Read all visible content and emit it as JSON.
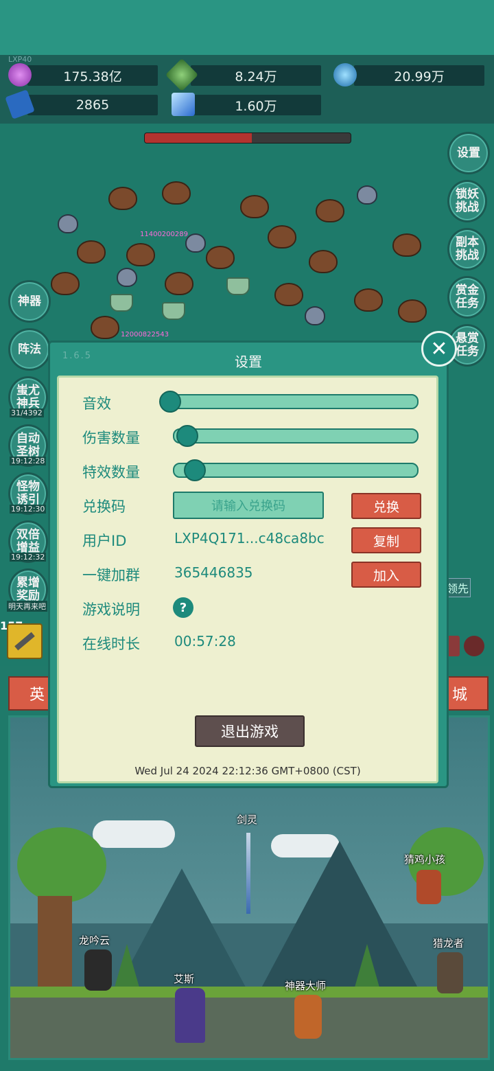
{
  "resources": {
    "level": "LXP40",
    "gem": "175.38亿",
    "green_crystal": "8.24万",
    "orb": "20.99万",
    "book": "2865",
    "blue_crystal": "1.60万"
  },
  "boss_hp_fraction": 0.52,
  "damage_numbers": [
    "11400200289",
    "12000822543"
  ],
  "left_menu": [
    {
      "label": "神器",
      "sub": ""
    },
    {
      "label": "阵法",
      "sub": ""
    },
    {
      "label": "蚩尤神兵",
      "sub": "31/4392"
    },
    {
      "label": "自动圣树",
      "sub": "19:12:28"
    },
    {
      "label": "怪物诱引",
      "sub": "19:12:30"
    },
    {
      "label": "双倍增益",
      "sub": "19:12:32"
    },
    {
      "label": "累增奖励",
      "sub": "明天再来吧"
    }
  ],
  "right_menu": [
    {
      "label": "设置"
    },
    {
      "label": "锁妖挑战"
    },
    {
      "label": "副本挑战"
    },
    {
      "label": "赏金任务"
    },
    {
      "label": "悬赏任务"
    }
  ],
  "partial": {
    "priority_tag": "领先",
    "counter": "157",
    "tab_left": "英",
    "tab_right": "城"
  },
  "settings": {
    "version": "1.6.5",
    "title": "设置",
    "sound_label": "音效",
    "sound_value": 0.0,
    "damage_count_label": "伤害数量",
    "damage_count_value": 0.05,
    "effect_count_label": "特效数量",
    "effect_count_value": 0.08,
    "redeem_label": "兑换码",
    "redeem_placeholder": "请输入兑换码",
    "redeem_button": "兑换",
    "user_id_label": "用户ID",
    "user_id_value": "LXP4Q171...c48ca8bc",
    "copy_button": "复制",
    "group_label": "一键加群",
    "group_value": "365446835",
    "join_button": "加入",
    "guide_label": "游戏说明",
    "guide_icon": "?",
    "online_label": "在线时长",
    "online_value": "00:57:28",
    "exit_button": "退出游戏",
    "datetime": "Wed Jul 24 2024 22:12:36 GMT+0800 (CST)"
  },
  "characters": {
    "sword": "剑灵",
    "chicken_kid": "猜鸡小孩",
    "long_yinyun": "龙吟云",
    "dragon_hunter": "猎龙者",
    "aisi": "艾斯",
    "artifact_master": "神器大师"
  }
}
